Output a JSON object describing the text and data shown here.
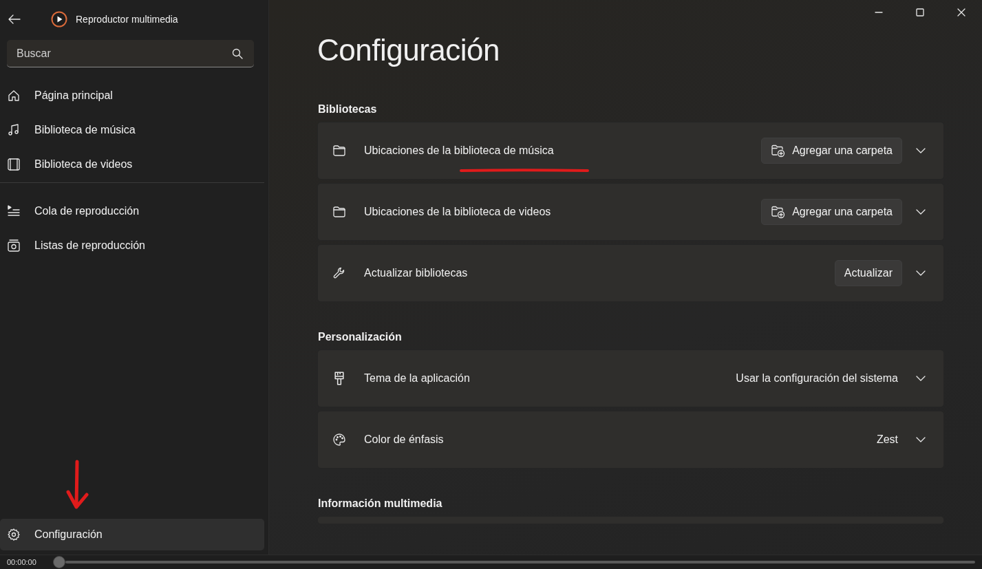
{
  "window": {
    "title": "Reproductor multimedia"
  },
  "search": {
    "placeholder": "Buscar"
  },
  "sidebar": {
    "groups": [
      {
        "items": [
          {
            "label": "Página principal",
            "selected": false
          },
          {
            "label": "Biblioteca de música",
            "selected": false
          },
          {
            "label": "Biblioteca de videos",
            "selected": false
          }
        ]
      },
      {
        "items": [
          {
            "label": "Cola de reproducción",
            "selected": false
          },
          {
            "label": "Listas de reproducción",
            "selected": false
          }
        ]
      }
    ],
    "footer_item": {
      "label": "Configuración",
      "selected": true
    }
  },
  "page": {
    "title": "Configuración",
    "sections": [
      {
        "heading": "Bibliotecas",
        "cards": [
          {
            "label": "Ubicaciones de la biblioteca de música",
            "kind": "folder_button",
            "control": "Agregar una carpeta",
            "underlined": true
          },
          {
            "label": "Ubicaciones de la biblioteca de videos",
            "kind": "folder_button",
            "control": "Agregar una carpeta",
            "underlined": false
          },
          {
            "label": "Actualizar bibliotecas",
            "kind": "button",
            "control": "Actualizar",
            "underlined": false
          }
        ]
      },
      {
        "heading": "Personalización",
        "cards": [
          {
            "label": "Tema de la aplicación",
            "kind": "value",
            "control": "Usar la configuración del sistema",
            "underlined": false
          },
          {
            "label": "Color de énfasis",
            "kind": "value",
            "control": "Zest",
            "underlined": false
          }
        ]
      },
      {
        "heading": "Información multimedia"
      }
    ]
  },
  "player": {
    "time": "00:00:00",
    "level": 0
  },
  "annotation_arrow": true
}
